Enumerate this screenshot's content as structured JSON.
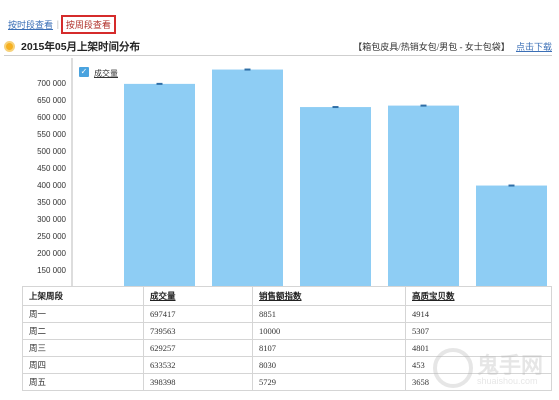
{
  "tabs": [
    {
      "label": "按时段查看",
      "active": false
    },
    {
      "label": "按周段查看",
      "active": true
    }
  ],
  "tab_separator": "|",
  "header": {
    "title": "2015年05月上架时间分布",
    "categories": "【箱包皮具/热销女包/男包 - 女士包袋】",
    "download_link": "点击下载",
    "icon": "circle-bullet-icon"
  },
  "legend": {
    "label": "成交量",
    "checked": true,
    "icon": "checkmark-icon"
  },
  "chart_data": {
    "type": "bar",
    "categories": [
      "周一",
      "周二",
      "周三",
      "周四",
      "周五"
    ],
    "series": [
      {
        "name": "成交量",
        "values": [
          697417,
          739563,
          629257,
          633532,
          398398
        ]
      }
    ],
    "ylim": [
      150000,
      750000
    ],
    "yticks": [
      "700 000",
      "650 000",
      "600 000",
      "550 000",
      "500 000",
      "450 000",
      "400 000",
      "350 000",
      "300 000",
      "250 000",
      "200 000",
      "150 000"
    ],
    "ytick_values": [
      700000,
      650000,
      600000,
      550000,
      500000,
      450000,
      400000,
      350000,
      300000,
      250000,
      200000,
      150000
    ],
    "bar_color": "#8ecdf4",
    "grid": false
  },
  "table": {
    "headers": [
      "上架周段",
      "成交量",
      "销售额指数",
      "高质宝贝数"
    ],
    "rows": [
      [
        "周一",
        "697417",
        "8851",
        "4914"
      ],
      [
        "周二",
        "739563",
        "10000",
        "5307"
      ],
      [
        "周三",
        "629257",
        "8107",
        "4801"
      ],
      [
        "周四",
        "633532",
        "8030",
        "453"
      ],
      [
        "周五",
        "398398",
        "5729",
        "3658"
      ]
    ]
  },
  "watermark": {
    "text": "鬼手网",
    "sub": "shuaishou.com",
    "icon": "circle-logo-icon"
  },
  "colors": {
    "tab_link": "#3b6fb6",
    "active_tab_border": "#d52b2b",
    "bar": "#8ecdf4"
  }
}
